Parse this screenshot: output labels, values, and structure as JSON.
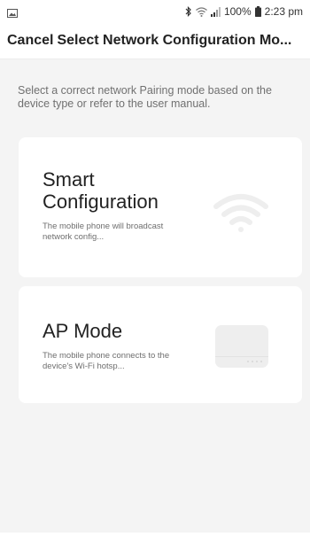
{
  "status_bar": {
    "left_icon": "image-icon",
    "bluetooth_icon": "bluetooth-icon",
    "wifi_icon": "wifi-icon",
    "signal_icon": "signal-icon",
    "battery_percent": "100%",
    "battery_icon": "battery-icon",
    "time": "2:23 pm"
  },
  "header": {
    "cancel_label": "Cancel",
    "title": "Select Network Configuration Mo..."
  },
  "main": {
    "instructions": "Select a correct network Pairing mode based on the device type or refer to the user manual.",
    "modes": [
      {
        "title": "Smart Configuration",
        "description": "The mobile phone will broadcast network config...",
        "icon": "wifi-icon"
      },
      {
        "title": "AP Mode",
        "description": "The mobile phone connects to the device's Wi-Fi hotsp...",
        "icon": "router-icon"
      }
    ]
  }
}
